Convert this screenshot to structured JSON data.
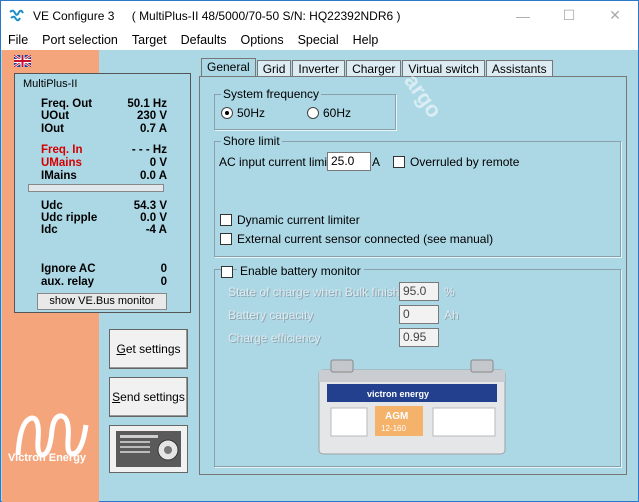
{
  "window": {
    "app_name": "VE Configure 3",
    "device_info": "( MultiPlus-II 48/5000/70-50 S/N: HQ22392NDR6 )",
    "minimize": "—",
    "maximize": "☐",
    "close": "✕"
  },
  "menu": [
    "File",
    "Port selection",
    "Target",
    "Defaults",
    "Options",
    "Special",
    "Help"
  ],
  "status": {
    "title": "MultiPlus-II",
    "rows": [
      {
        "label": "Freq. Out",
        "value": "50.1 Hz"
      },
      {
        "label": "UOut",
        "value": "230 V"
      },
      {
        "label": "IOut",
        "value": "0.7 A"
      },
      {
        "label": "Freq. In",
        "value": "- - - Hz"
      },
      {
        "label": "UMains",
        "value": "0 V"
      },
      {
        "label": "IMains",
        "value": "0.0 A"
      },
      {
        "label": "Udc",
        "value": "54.3 V"
      },
      {
        "label": "Udc ripple",
        "value": "0.0 V"
      },
      {
        "label": "Idc",
        "value": "-4 A"
      },
      {
        "label": "Ignore AC",
        "value": "0"
      },
      {
        "label": "aux. relay",
        "value": "0"
      }
    ],
    "vebus_button": "show VE.Bus monitor"
  },
  "buttons": {
    "get_settings": "Get settings",
    "send_settings": "Send settings"
  },
  "logo_text": "Victron Energy",
  "tabs": [
    "General",
    "Grid",
    "Inverter",
    "Charger",
    "Virtual switch",
    "Assistants"
  ],
  "general": {
    "system_frequency": {
      "title": "System frequency",
      "opt1": "50Hz",
      "opt2": "60Hz",
      "selected": "50Hz"
    },
    "shore_limit": {
      "title": "Shore limit",
      "ac_input_label": "AC input current limit",
      "ac_input_value": "25.0",
      "ac_input_unit": "A",
      "overruled": "Overruled by remote",
      "dynamic_limiter": "Dynamic current limiter",
      "external_sensor": "External current sensor connected (see manual)"
    },
    "battery_monitor": {
      "enable": "Enable battery monitor",
      "soc_label": "State of charge when Bulk finished",
      "soc_value": "95.0",
      "soc_unit": "%",
      "capacity_label": "Battery capacity",
      "capacity_value": "0",
      "capacity_unit": "Ah",
      "efficiency_label": "Charge efficiency",
      "efficiency_value": "0.95"
    }
  },
  "battery_image": {
    "brand": "victron energy",
    "type": "AGM",
    "model": "12-160"
  },
  "colors": {
    "window_bg": "#acd7e5",
    "left_strip": "#f5a57c",
    "red_label": "#d40000",
    "desktop": "#2f7fd3"
  }
}
